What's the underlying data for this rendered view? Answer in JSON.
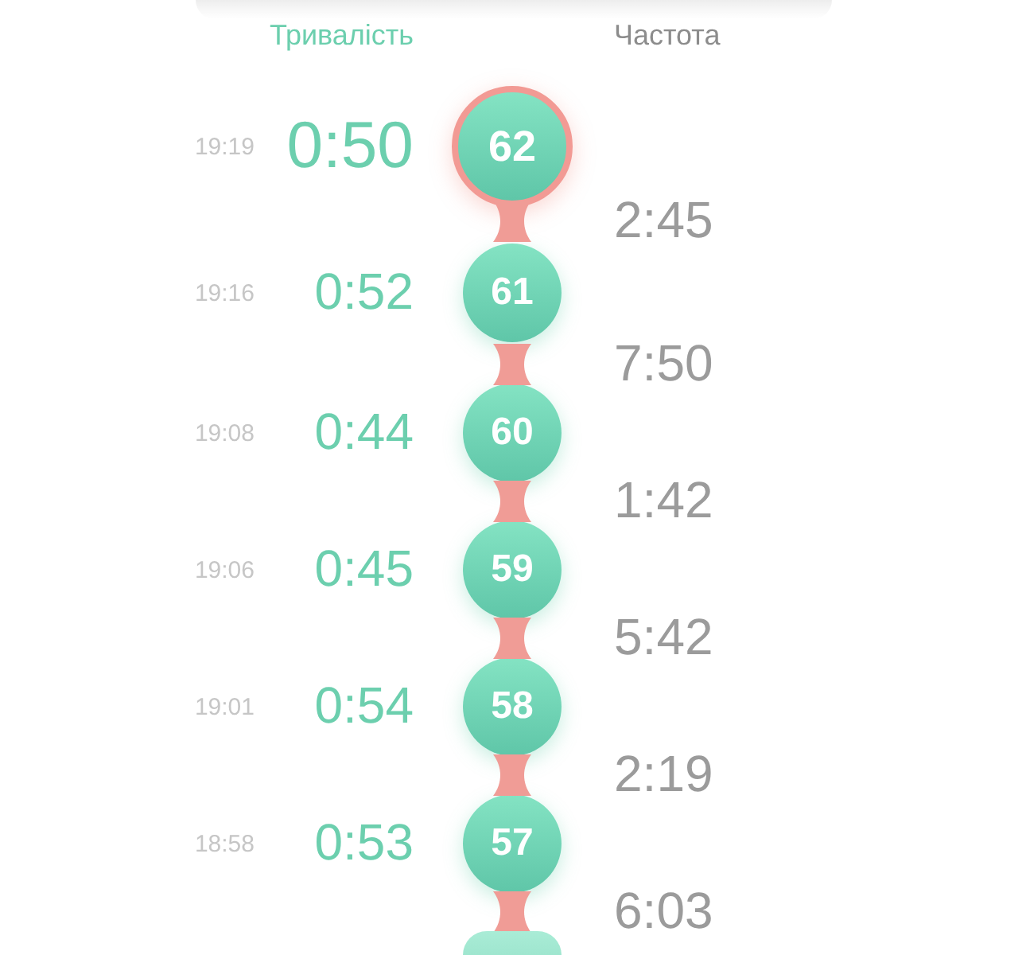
{
  "columns": {
    "duration_header": "Тривалість",
    "frequency_header": "Частота"
  },
  "contractions": [
    {
      "time": "19:19",
      "duration": "0:50",
      "number": "62",
      "current": true
    },
    {
      "time": "19:16",
      "duration": "0:52",
      "number": "61",
      "current": false
    },
    {
      "time": "19:08",
      "duration": "0:44",
      "number": "60",
      "current": false
    },
    {
      "time": "19:06",
      "duration": "0:45",
      "number": "59",
      "current": false
    },
    {
      "time": "19:01",
      "duration": "0:54",
      "number": "58",
      "current": false
    },
    {
      "time": "18:58",
      "duration": "0:53",
      "number": "57",
      "current": false
    }
  ],
  "frequencies": [
    "2:45",
    "7:50",
    "1:42",
    "5:42",
    "2:19",
    "6:03"
  ],
  "more_below": true
}
